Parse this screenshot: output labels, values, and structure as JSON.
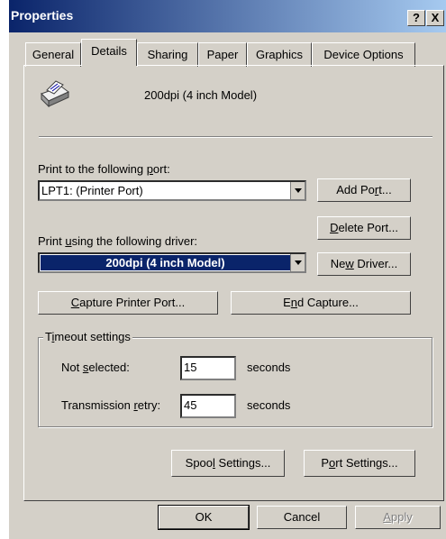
{
  "window": {
    "title": "Properties"
  },
  "title_buttons": {
    "help": "?",
    "close": "X"
  },
  "tabs": [
    "General",
    "Details",
    "Sharing",
    "Paper",
    "Graphics",
    "Device Options"
  ],
  "printer": {
    "icon": "printer-icon",
    "model_name": "200dpi (4 inch Model)"
  },
  "port": {
    "label_pre": "Print to the following ",
    "label_key": "p",
    "label_post": "ort:",
    "selected": "LPT1:  (Printer Port)",
    "add_pre": "Add Po",
    "add_key": "r",
    "add_post": "t...",
    "delete_pre": "",
    "delete_key": "D",
    "delete_post": "elete Port..."
  },
  "driver": {
    "label_pre": "Print ",
    "label_key": "u",
    "label_post": "sing the following driver:",
    "selected": "200dpi (4 inch Model)",
    "new_pre": "Ne",
    "new_key": "w",
    "new_post": " Driver..."
  },
  "capture": {
    "capture_pre": "",
    "capture_key": "C",
    "capture_post": "apture Printer Port...",
    "end_pre": "E",
    "end_key": "n",
    "end_post": "d Capture..."
  },
  "timeout": {
    "group_pre": "T",
    "group_key": "i",
    "group_post": "meout settings",
    "not_selected_pre": "Not ",
    "not_selected_key": "s",
    "not_selected_post": "elected:",
    "not_selected_value": "15",
    "retry_pre": "Transmission ",
    "retry_key": "r",
    "retry_post": "etry:",
    "retry_value": "45",
    "unit": "seconds"
  },
  "spool": {
    "spool_pre": "Spoo",
    "spool_key": "l",
    "spool_post": " Settings...",
    "port_pre": "P",
    "port_key": "o",
    "port_post": "rt Settings..."
  },
  "footer": {
    "ok": "OK",
    "cancel": "Cancel",
    "apply_pre": "",
    "apply_key": "A",
    "apply_post": "pply"
  },
  "colors": {
    "title_bar": "#0a246a",
    "selection": "#0a246a",
    "dialog_face": "#d4d0c8"
  }
}
